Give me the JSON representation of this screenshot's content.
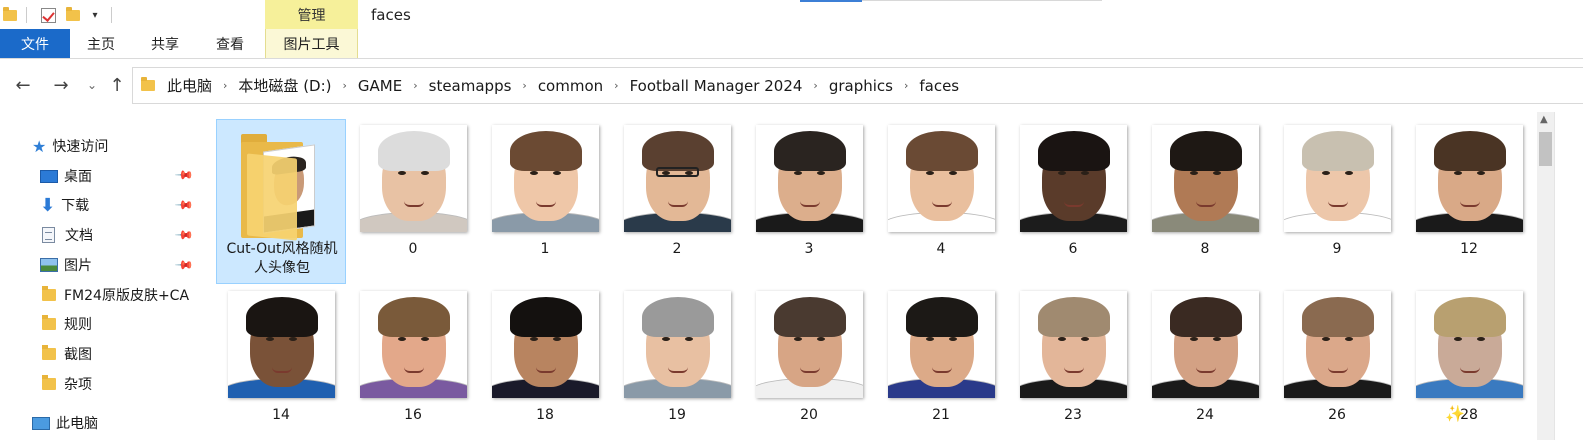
{
  "window": {
    "title": "faces",
    "contextual_tab_group": "管理"
  },
  "ribbon": {
    "tabs": [
      "文件",
      "主页",
      "共享",
      "查看"
    ],
    "contextual_tab": "图片工具"
  },
  "address": {
    "breadcrumbs": [
      "此电脑",
      "本地磁盘 (D:)",
      "GAME",
      "steamapps",
      "common",
      "Football Manager 2024",
      "graphics",
      "faces"
    ]
  },
  "sidebar": {
    "quick_access": "快速访问",
    "items": [
      {
        "label": "桌面",
        "icon": "desktop-icon",
        "pinned": true
      },
      {
        "label": "下载",
        "icon": "download-icon",
        "pinned": true
      },
      {
        "label": "文档",
        "icon": "document-icon",
        "pinned": true
      },
      {
        "label": "图片",
        "icon": "pictures-icon",
        "pinned": true
      },
      {
        "label": "FM24原版皮肤+CA",
        "icon": "folder-icon",
        "pinned": false
      },
      {
        "label": "规则",
        "icon": "folder-icon",
        "pinned": false
      },
      {
        "label": "截图",
        "icon": "folder-icon",
        "pinned": false
      },
      {
        "label": "杂项",
        "icon": "folder-icon",
        "pinned": false
      }
    ],
    "this_pc": "此电脑"
  },
  "files": [
    {
      "name": "Cut-Out风格随机人头像包",
      "type": "folder",
      "selected": true
    },
    {
      "name": "0",
      "type": "image"
    },
    {
      "name": "1",
      "type": "image"
    },
    {
      "name": "2",
      "type": "image"
    },
    {
      "name": "3",
      "type": "image"
    },
    {
      "name": "4",
      "type": "image"
    },
    {
      "name": "6",
      "type": "image"
    },
    {
      "name": "8",
      "type": "image"
    },
    {
      "name": "9",
      "type": "image"
    },
    {
      "name": "12",
      "type": "image"
    },
    {
      "name": "14",
      "type": "image"
    },
    {
      "name": "16",
      "type": "image"
    },
    {
      "name": "18",
      "type": "image"
    },
    {
      "name": "19",
      "type": "image"
    },
    {
      "name": "20",
      "type": "image"
    },
    {
      "name": "21",
      "type": "image"
    },
    {
      "name": "23",
      "type": "image"
    },
    {
      "name": "24",
      "type": "image"
    },
    {
      "name": "26",
      "type": "image"
    },
    {
      "name": "28",
      "type": "image"
    }
  ],
  "colors": {
    "file_tab": "#1b6ac9",
    "manage_tab": "#f6f09a",
    "selection": "#cce8ff"
  }
}
